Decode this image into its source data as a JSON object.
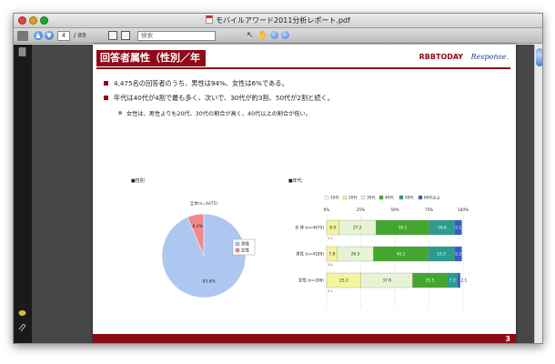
{
  "window": {
    "title": "モバイルアワード2011分析レポート.pdf"
  },
  "toolbar": {
    "current_page": "4",
    "total_pages": "/ 89",
    "search_placeholder": "検索"
  },
  "slide": {
    "title": "回答者属性（性別／年代）",
    "logo_rbb": "RBBTODAY",
    "logo_response": "Response.",
    "bullets": [
      "4,475名の回答者のうち、男性は94%、女性は6%である。",
      "年代は40代が4割で最も多く、次いで、30代が約3割、50代が2割と続く。"
    ],
    "sub_bullet": "女性は、男性よりも20代、30代の割合が高く、40代以上の割合が低い。",
    "page_number": "3"
  },
  "chart_data": [
    {
      "type": "pie",
      "title": "■性別",
      "subtitle": "全体(n=4475)",
      "labels": [
        "男性",
        "女性"
      ],
      "values": [
        93.6,
        6.4
      ],
      "value_labels": [
        "93.6%",
        "6.4%"
      ],
      "colors": [
        "#aec7f0",
        "#f08a8a"
      ],
      "legend_placement": "right"
    },
    {
      "type": "bar",
      "orientation": "horizontal",
      "stacked": true,
      "title": "■年代",
      "series_names": [
        "10代",
        "20代",
        "30代",
        "40代",
        "50代",
        "60代以上"
      ],
      "colors": [
        "#ffffff",
        "#f4f49c",
        "#e6f4d4",
        "#44a62e",
        "#2c9c8e",
        "#2f5fc8"
      ],
      "categories": [
        "全 体 (n=4475)",
        "男性 (n=4189)",
        "女性 (n=286)"
      ],
      "rows": [
        [
          0,
          8.9,
          27.2,
          39.2,
          18.6,
          5.1
        ],
        [
          0,
          7.8,
          26.5,
          40.1,
          19.3,
          5.3
        ],
        [
          0,
          25.2,
          37.8,
          25.5,
          7.3,
          2.1
        ]
      ],
      "row_labels": [
        [
          "",
          "8.9",
          "27.2",
          "39.2",
          "18.6",
          "5.1"
        ],
        [
          "",
          "7.8",
          "26.5",
          "40.1",
          "19.3",
          "5.3"
        ],
        [
          "",
          "25.2",
          "37.8",
          "25.5",
          "7.3",
          "2.1"
        ]
      ],
      "below_labels": [
        "1.1",
        "1.0",
        "2.1"
      ],
      "xticks": [
        "0%",
        "25%",
        "50%",
        "75%",
        "100%"
      ],
      "xlim": [
        0,
        100
      ],
      "legend_placement": "top"
    }
  ]
}
